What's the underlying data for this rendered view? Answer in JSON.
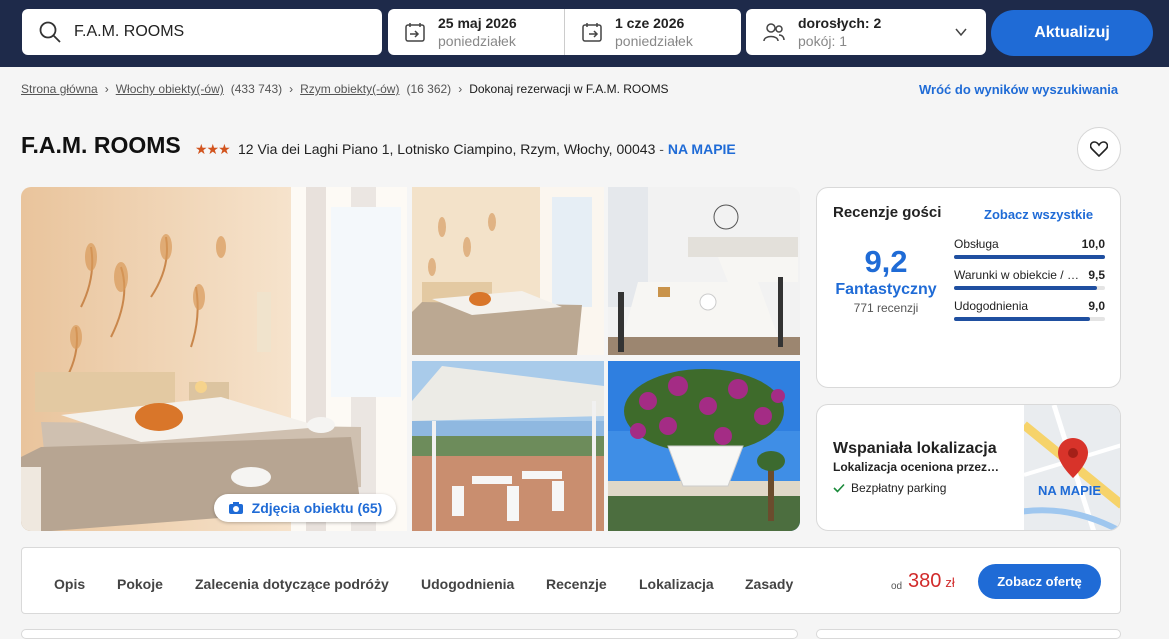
{
  "search": {
    "destination": "F.A.M. ROOMS"
  },
  "dates": {
    "checkin": {
      "date": "25 maj 2026",
      "day": "poniedziałek"
    },
    "checkout": {
      "date": "1 cze 2026",
      "day": "poniedziałek"
    }
  },
  "guests": {
    "adults": "dorosłych: 2",
    "rooms": "pokój: 1"
  },
  "update_label": "Aktualizuj",
  "breadcrumb": {
    "items": [
      {
        "label": "Strona główna",
        "count": ""
      },
      {
        "label": "Włochy obiekty(-ów)",
        "count": "(433 743)"
      },
      {
        "label": "Rzym obiekty(-ów)",
        "count": "(16 362)"
      }
    ],
    "current": "Dokonaj rezerwacji w F.A.M. ROOMS"
  },
  "back_link": "Wróć do wyników wyszukiwania",
  "hotel": {
    "name": "F.A.M. ROOMS",
    "stars": "★★★",
    "address": "12 Via dei Laghi Piano 1, Lotnisko Ciampino, Rzym, Włochy, 00043",
    "dash": " - ",
    "map_link": "NA MAPIE"
  },
  "photos_button": "Zdjęcia obiektu (65)",
  "reviews": {
    "heading": "Recenzje gości",
    "see_all": "Zobacz wszystkie",
    "score": "9,2",
    "verdict": "Fantastyczny",
    "count": "771 recenzji",
    "ratings": [
      {
        "label": "Obsługa",
        "value": "10,0",
        "fraction": 1.0
      },
      {
        "label": "Warunki w obiekcie / czystość",
        "value": "9,5",
        "fraction": 0.95
      },
      {
        "label": "Udogodnienia",
        "value": "9,0",
        "fraction": 0.9
      }
    ]
  },
  "location": {
    "heading": "Wspaniała lokalizacja",
    "subheading": "Lokalizacja oceniona przez…",
    "parking": "Bezpłatny parking",
    "map_label": "NA MAPIE"
  },
  "tabs": [
    "Opis",
    "Pokoje",
    "Zalecenia dotyczące podróży",
    "Udogodnienia",
    "Recenzje",
    "Lokalizacja",
    "Zasady"
  ],
  "price": {
    "from": "od",
    "amount": "380",
    "currency": "zł"
  },
  "offer_button": "Zobacz ofertę",
  "colors": {
    "nav_bg": "#1e2a4a",
    "accent": "#1f6bd6",
    "price": "#d12b2b",
    "stars": "#d2541e"
  }
}
